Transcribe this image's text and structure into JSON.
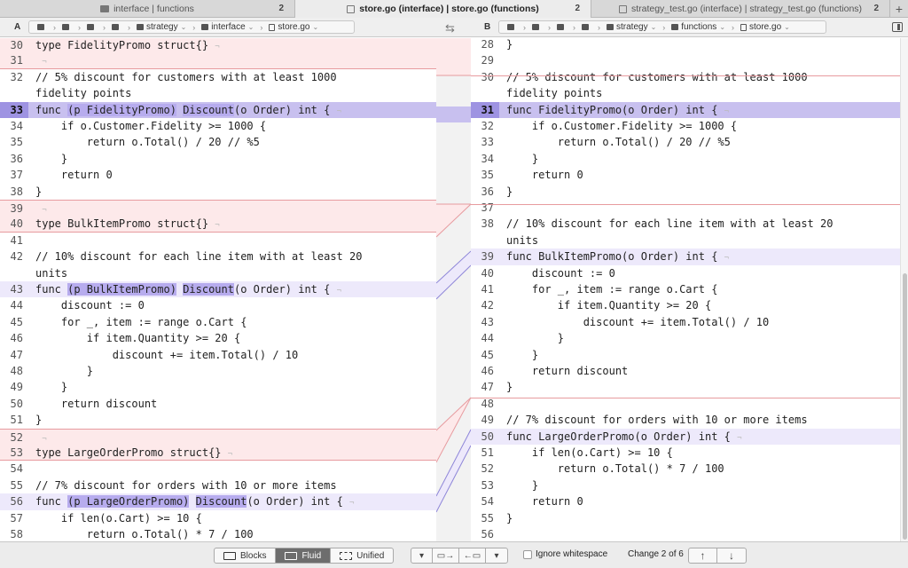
{
  "tabs": [
    {
      "label": "interface | functions",
      "count": "2",
      "icon": "folder-icon"
    },
    {
      "label": "store.go (interface) | store.go (functions)",
      "count": "2",
      "icon": "file-icon"
    },
    {
      "label": "strategy_test.go (interface) | strategy_test.go (functions)",
      "count": "2",
      "icon": "file-icon"
    }
  ],
  "path_left": {
    "side": "A",
    "crumbs": [
      "strategy",
      "interface",
      "store.go"
    ]
  },
  "path_right": {
    "side": "B",
    "crumbs": [
      "strategy",
      "functions",
      "store.go"
    ]
  },
  "left_lines": [
    {
      "n": "30",
      "t": "type FidelityPromo struct{}",
      "k": "del"
    },
    {
      "n": "31",
      "t": "",
      "k": "del"
    },
    {
      "n": "32",
      "t": "// 5% discount for customers with at least 1000\nfidelity points",
      "k": "ctx"
    },
    {
      "n": "33",
      "t": "func (p FidelityPromo) Discount(o Order) int {",
      "k": "chg-strong"
    },
    {
      "n": "34",
      "t": "    if o.Customer.Fidelity >= 1000 {",
      "k": "ctx"
    },
    {
      "n": "35",
      "t": "        return o.Total() / 20 // %5",
      "k": "ctx"
    },
    {
      "n": "36",
      "t": "    }",
      "k": "ctx"
    },
    {
      "n": "37",
      "t": "    return 0",
      "k": "ctx"
    },
    {
      "n": "38",
      "t": "}",
      "k": "ctx"
    },
    {
      "n": "39",
      "t": "",
      "k": "del"
    },
    {
      "n": "40",
      "t": "type BulkItemPromo struct{}",
      "k": "del"
    },
    {
      "n": "41",
      "t": "",
      "k": "ctx"
    },
    {
      "n": "42",
      "t": "// 10% discount for each line item with at least 20\nunits",
      "k": "ctx"
    },
    {
      "n": "43",
      "t": "func (p BulkItemPromo) Discount(o Order) int {",
      "k": "chg"
    },
    {
      "n": "44",
      "t": "    discount := 0",
      "k": "ctx"
    },
    {
      "n": "45",
      "t": "    for _, item := range o.Cart {",
      "k": "ctx"
    },
    {
      "n": "46",
      "t": "        if item.Quantity >= 20 {",
      "k": "ctx"
    },
    {
      "n": "47",
      "t": "            discount += item.Total() / 10",
      "k": "ctx"
    },
    {
      "n": "48",
      "t": "        }",
      "k": "ctx"
    },
    {
      "n": "49",
      "t": "    }",
      "k": "ctx"
    },
    {
      "n": "50",
      "t": "    return discount",
      "k": "ctx"
    },
    {
      "n": "51",
      "t": "}",
      "k": "ctx"
    },
    {
      "n": "52",
      "t": "",
      "k": "del"
    },
    {
      "n": "53",
      "t": "type LargeOrderPromo struct{}",
      "k": "del"
    },
    {
      "n": "54",
      "t": "",
      "k": "ctx"
    },
    {
      "n": "55",
      "t": "// 7% discount for orders with 10 or more items",
      "k": "ctx"
    },
    {
      "n": "56",
      "t": "func (p LargeOrderPromo) Discount(o Order) int {",
      "k": "chg"
    },
    {
      "n": "57",
      "t": "    if len(o.Cart) >= 10 {",
      "k": "ctx"
    },
    {
      "n": "58",
      "t": "        return o.Total() * 7 / 100",
      "k": "ctx"
    }
  ],
  "right_lines": [
    {
      "n": "28",
      "t": "}",
      "k": "ctx"
    },
    {
      "n": "29",
      "t": "",
      "k": "ctx"
    },
    {
      "n": "30",
      "t": "// 5% discount for customers with at least 1000\nfidelity points",
      "k": "ctx"
    },
    {
      "n": "31",
      "t": "func FidelityPromo(o Order) int {",
      "k": "chg-strong"
    },
    {
      "n": "32",
      "t": "    if o.Customer.Fidelity >= 1000 {",
      "k": "ctx"
    },
    {
      "n": "33",
      "t": "        return o.Total() / 20 // %5",
      "k": "ctx"
    },
    {
      "n": "34",
      "t": "    }",
      "k": "ctx"
    },
    {
      "n": "35",
      "t": "    return 0",
      "k": "ctx"
    },
    {
      "n": "36",
      "t": "}",
      "k": "ctx"
    },
    {
      "n": "37",
      "t": "",
      "k": "ctx"
    },
    {
      "n": "38",
      "t": "// 10% discount for each line item with at least 20\nunits",
      "k": "ctx"
    },
    {
      "n": "39",
      "t": "func BulkItemPromo(o Order) int {",
      "k": "chg"
    },
    {
      "n": "40",
      "t": "    discount := 0",
      "k": "ctx"
    },
    {
      "n": "41",
      "t": "    for _, item := range o.Cart {",
      "k": "ctx"
    },
    {
      "n": "42",
      "t": "        if item.Quantity >= 20 {",
      "k": "ctx"
    },
    {
      "n": "43",
      "t": "            discount += item.Total() / 10",
      "k": "ctx"
    },
    {
      "n": "44",
      "t": "        }",
      "k": "ctx"
    },
    {
      "n": "45",
      "t": "    }",
      "k": "ctx"
    },
    {
      "n": "46",
      "t": "    return discount",
      "k": "ctx"
    },
    {
      "n": "47",
      "t": "}",
      "k": "ctx"
    },
    {
      "n": "48",
      "t": "",
      "k": "ctx"
    },
    {
      "n": "49",
      "t": "// 7% discount for orders with 10 or more items",
      "k": "ctx"
    },
    {
      "n": "50",
      "t": "func LargeOrderPromo(o Order) int {",
      "k": "chg"
    },
    {
      "n": "51",
      "t": "    if len(o.Cart) >= 10 {",
      "k": "ctx"
    },
    {
      "n": "52",
      "t": "        return o.Total() * 7 / 100",
      "k": "ctx"
    },
    {
      "n": "53",
      "t": "    }",
      "k": "ctx"
    },
    {
      "n": "54",
      "t": "    return 0",
      "k": "ctx"
    },
    {
      "n": "55",
      "t": "}",
      "k": "ctx"
    },
    {
      "n": "56",
      "t": "",
      "k": "ctx"
    }
  ],
  "toolbar": {
    "blocks_label": "Blocks",
    "fluid_label": "Fluid",
    "unified_label": "Unified",
    "ignore_ws_label": "Ignore whitespace",
    "change_label": "Change 2 of 6"
  },
  "colors": {
    "deleted_bg": "#fde9ea",
    "changed_bg": "#ede9fb",
    "changed_active_bg": "#c8c0ef",
    "highlight": "#b7acee",
    "connector_red": "#e79b9f",
    "connector_purple": "#8e86d8"
  }
}
